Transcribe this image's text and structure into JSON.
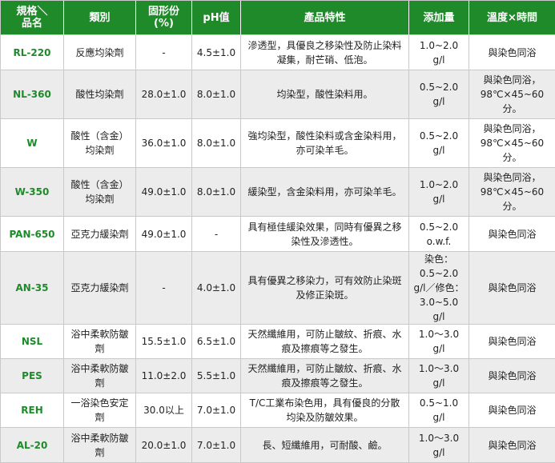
{
  "colors": {
    "header_bg": "#1e8a2a",
    "header_text": "#ffffff",
    "code_text": "#1e8a2a",
    "zebra": "#ececec",
    "border": "#c9c9c9"
  },
  "headers": {
    "corner_top": "規格＼",
    "corner_bottom": "品名",
    "category": "類別",
    "solids": "固形份(%)",
    "ph": "pH值",
    "features": "產品特性",
    "dosage": "添加量",
    "temp_time": "溫度×時間"
  },
  "rows": [
    {
      "code": "RL-220",
      "category": "反應均染劑",
      "solids": "-",
      "ph": "4.5±1.0",
      "features": "滲透型，具優良之移染性及防止染料凝集，耐芒硝、低泡。",
      "dosage": "1.0~2.0 g/l",
      "temp_time": "與染色同浴"
    },
    {
      "code": "NL-360",
      "category": "酸性均染劑",
      "solids": "28.0±1.0",
      "ph": "8.0±1.0",
      "features": "均染型，酸性染料用。",
      "dosage": "0.5~2.0 g/l",
      "temp_time": "與染色同浴，98℃×45~60分。"
    },
    {
      "code": "W",
      "category": "酸性（含金）均染劑",
      "solids": "36.0±1.0",
      "ph": "8.0±1.0",
      "features": "強均染型，酸性染料或含金染料用，亦可染羊毛。",
      "dosage": "0.5~2.0 g/l",
      "temp_time": "與染色同浴，98℃×45~60分。"
    },
    {
      "code": "W-350",
      "category": "酸性（含金）均染劑",
      "solids": "49.0±1.0",
      "ph": "8.0±1.0",
      "features": "緩染型，含金染料用，亦可染羊毛。",
      "dosage": "1.0~2.0 g/l",
      "temp_time": "與染色同浴，98℃×45~60分。"
    },
    {
      "code": "PAN-650",
      "category": "亞克力緩染劑",
      "solids": "49.0±1.0",
      "ph": "-",
      "features": "具有極佳緩染效果，同時有優異之移染性及滲透性。",
      "dosage": "0.5~2.0 o.w.f.",
      "temp_time": "與染色同浴"
    },
    {
      "code": "AN-35",
      "category": "亞克力緩染劑",
      "solids": "-",
      "ph": "4.0±1.0",
      "features": "具有優異之移染力，可有效防止染斑及修正染斑。",
      "dosage": "染色：0.5~2.0 g/l／修色：3.0~5.0 g/l",
      "temp_time": "與染色同浴"
    },
    {
      "code": "NSL",
      "category": "浴中柔軟防皺劑",
      "solids": "15.5±1.0",
      "ph": "6.5±1.0",
      "features": "天然纖維用，可防止皺紋、折痕、水痕及擦痕等之發生。",
      "dosage": "1.0～3.0 g/l",
      "temp_time": "與染色同浴"
    },
    {
      "code": "PES",
      "category": "浴中柔軟防皺劑",
      "solids": "11.0±2.0",
      "ph": "5.5±1.0",
      "features": "天然纖維用，可防止皺紋、折痕、水痕及擦痕等之發生。",
      "dosage": "1.0～3.0 g/l",
      "temp_time": "與染色同浴"
    },
    {
      "code": "REH",
      "category": "一浴染色安定劑",
      "solids": "30.0以上",
      "ph": "7.0±1.0",
      "features": "T/C工業布染色用，具有優良的分散均染及防皺效果。",
      "dosage": "0.5~1.0 g/l",
      "temp_time": "與染色同浴"
    },
    {
      "code": "AL-20",
      "category": "浴中柔軟防皺劑",
      "solids": "20.0±1.0",
      "ph": "7.0±1.0",
      "features": "長、短纖維用，可耐酸、鹼。",
      "dosage": "1.0～3.0 g/l",
      "temp_time": "與染色同浴"
    }
  ]
}
